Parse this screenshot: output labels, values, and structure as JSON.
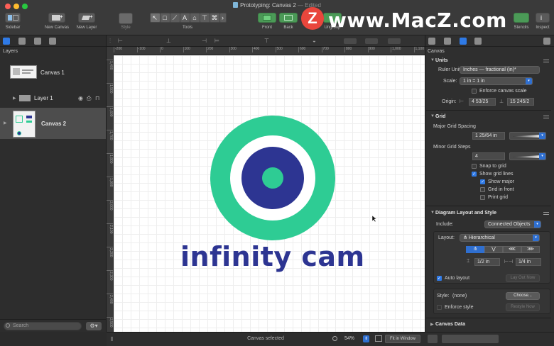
{
  "window": {
    "title": "Prototyping: Canvas 2",
    "edited": "— Edited"
  },
  "toolbar": {
    "sidebar": "Sidebar",
    "new_canvas": "New Canvas",
    "new_layer": "New Layer",
    "style": "Style",
    "tools": "Tools",
    "front": "Front",
    "back": "Back",
    "ungroup": "Ungroup",
    "stencils": "Stencils",
    "inspect": "Inspect",
    "tool_glyphs": [
      "↖",
      "□",
      "⟋",
      "A",
      "⌂",
      "⊤",
      "⌘",
      "›"
    ]
  },
  "watermark": {
    "badge": "Z",
    "text": "www.MacZ.com"
  },
  "sidebar": {
    "title": "Layers",
    "canvases": [
      {
        "label": "Canvas 1",
        "layers": [
          "Layer 1"
        ]
      },
      {
        "label": "Canvas 2"
      }
    ],
    "search_placeholder": "Search"
  },
  "rulers": {
    "h": [
      "-200",
      "-100",
      "0",
      "100",
      "200",
      "300",
      "400",
      "500",
      "600",
      "700",
      "800",
      "900",
      "1,000",
      "1,100"
    ],
    "v": [
      "1,400",
      "1,500",
      "1,600",
      "1,700",
      "1,800",
      "1,900",
      "2,000",
      "2,100",
      "2,200",
      "2,300",
      "2,400",
      "2,500"
    ]
  },
  "canvas": {
    "logo_text": "infinity cam",
    "colors": {
      "outer_ring": "#2ecc94",
      "inner_ring": "#2d3592",
      "center_dot": "#2ecc94",
      "text": "#2d3592"
    }
  },
  "status": {
    "text": "Canvas selected",
    "zoom": "54%",
    "fit_label": "Fit in Window"
  },
  "inspector": {
    "title": "Canvas",
    "units": {
      "heading": "Units",
      "ruler_units_label": "Ruler Units:",
      "ruler_units_value": "Inches — fractional (in)*",
      "scale_label": "Scale:",
      "scale_value": "1 in = 1 in",
      "enforce_scale": "Enforce canvas scale",
      "origin_label": "Origin:",
      "origin_x": "4 53/25",
      "origin_y": "15 245/2"
    },
    "grid": {
      "heading": "Grid",
      "major_label": "Major Grid Spacing",
      "major_value": "1 25/64 in",
      "minor_label": "Minor Grid Steps",
      "minor_value": "4",
      "snap": "Snap to grid",
      "show_lines": "Show grid lines",
      "show_major": "Show major",
      "grid_front": "Grid in front",
      "print_grid": "Print grid"
    },
    "diagram": {
      "heading": "Diagram Layout and Style",
      "include_label": "Include:",
      "include_value": "Connected Objects",
      "layout_label": "Layout:",
      "layout_value": "Hierarchical",
      "direction_glyphs": [
        "⋔",
        "⋁",
        "⋘",
        "⋙"
      ],
      "rank_sep": "1/2 in",
      "object_sep": "1/4 in",
      "auto_layout": "Auto layout",
      "lay_out_now": "Lay Out Now",
      "style_label": "Style:",
      "style_value": "(none)",
      "choose": "Choose...",
      "enforce_style": "Enforce style",
      "restyle_now": "Restyle Now"
    },
    "canvas_data": {
      "heading": "Canvas Data"
    }
  }
}
